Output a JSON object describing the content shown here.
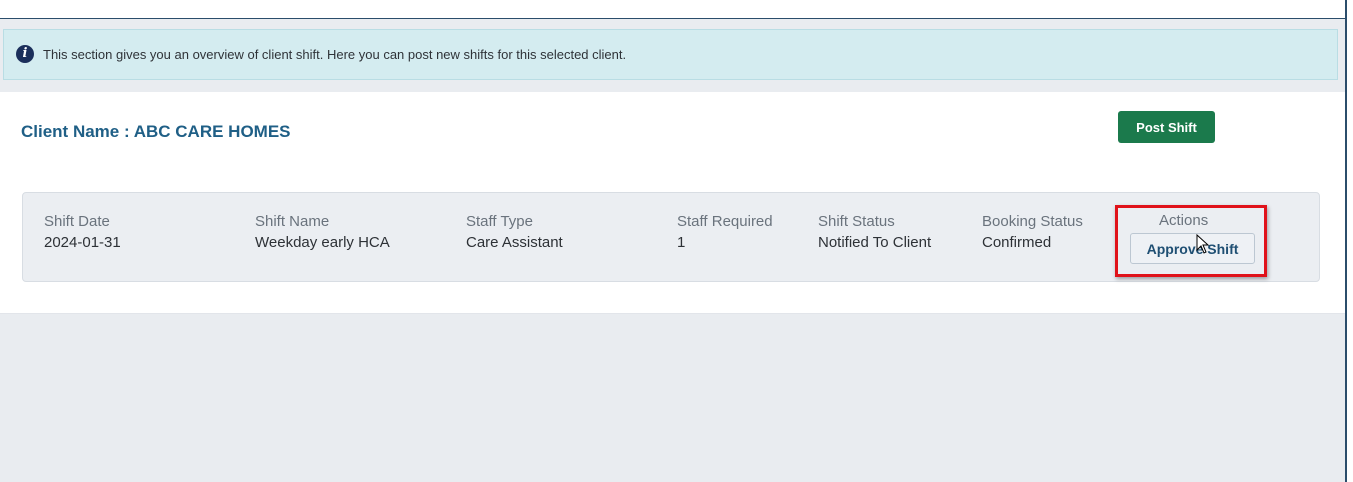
{
  "alert": {
    "icon": "info-icon",
    "icon_glyph": "i",
    "text": "This section gives you an overview of client shift. Here you can post new shifts for this selected client."
  },
  "client": {
    "name_label": "Client Name : ABC CARE HOMES"
  },
  "toolbar": {
    "post_shift_label": "Post Shift"
  },
  "shift": {
    "columns": [
      {
        "label": "Shift Date",
        "value": "2024-01-31"
      },
      {
        "label": "Shift Name",
        "value": "Weekday early HCA"
      },
      {
        "label": "Staff Type",
        "value": "Care Assistant"
      },
      {
        "label": "Staff Required",
        "value": "1"
      },
      {
        "label": "Shift Status",
        "value": "Notified To Client"
      },
      {
        "label": "Booking Status",
        "value": "Confirmed"
      }
    ],
    "actions_label": "Actions",
    "approve_label": "Approve Shift"
  },
  "colors": {
    "accent_green": "#1b7a4c",
    "title_blue": "#1f5f86",
    "highlight_red": "#e0121a",
    "alert_bg": "#d4ecf0"
  }
}
